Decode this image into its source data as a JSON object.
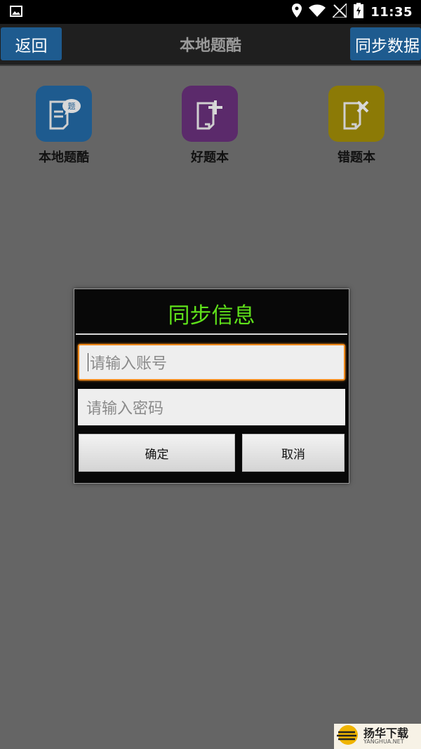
{
  "status_bar": {
    "time": "11:35",
    "icons": [
      "image-icon",
      "location-icon",
      "wifi-icon",
      "no-signal-icon",
      "battery-charging-icon"
    ]
  },
  "app_bar": {
    "back_label": "返回",
    "title": "本地题酷",
    "sync_label": "同步数据"
  },
  "features": [
    {
      "label": "本地题酷",
      "icon": "question-bubble-icon",
      "color": "#1e5b8f"
    },
    {
      "label": "好题本",
      "icon": "add-note-icon",
      "color": "#5b2a6b"
    },
    {
      "label": "错题本",
      "icon": "wrong-note-icon",
      "color": "#8c7a06"
    }
  ],
  "dialog": {
    "title": "同步信息",
    "account_placeholder": "请输入账号",
    "password_placeholder": "请输入密码",
    "confirm_label": "确定",
    "cancel_label": "取消",
    "title_color": "#5fe21a"
  },
  "watermark": {
    "name": "扬华下载",
    "domain": "YANGHUA.NET"
  }
}
